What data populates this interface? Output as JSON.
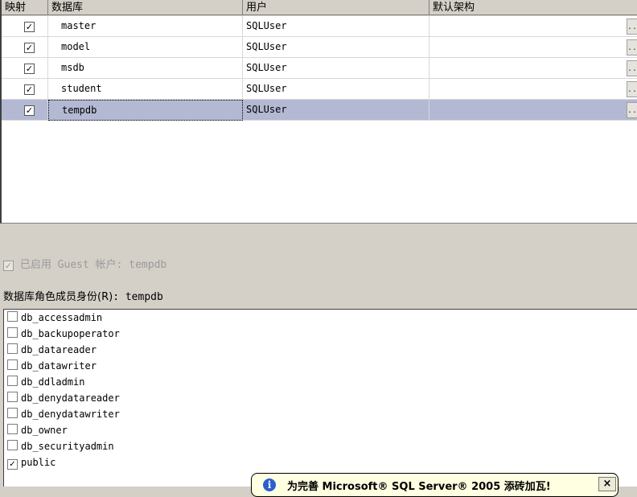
{
  "mapping_grid": {
    "headers": [
      "映射",
      "数据库",
      "用户",
      "默认架构"
    ],
    "rows": [
      {
        "mapped": true,
        "database": "master",
        "user": "SQLUser",
        "schema": "",
        "selected": false
      },
      {
        "mapped": true,
        "database": "model",
        "user": "SQLUser",
        "schema": "",
        "selected": false
      },
      {
        "mapped": true,
        "database": "msdb",
        "user": "SQLUser",
        "schema": "",
        "selected": false
      },
      {
        "mapped": true,
        "database": "student",
        "user": "SQLUser",
        "schema": "",
        "selected": false
      },
      {
        "mapped": true,
        "database": "tempdb",
        "user": "SQLUser",
        "schema": "",
        "selected": true
      }
    ],
    "ellipsis_label": "..",
    "selected_color": "#b3b9d3"
  },
  "guest": {
    "label": "已启用",
    "text": " Guest 帐户: tempdb",
    "checked": true,
    "enabled": false
  },
  "role_membership": {
    "caption_prefix": "数据库角色成员身份",
    "caption_mnemonic": "(R)",
    "caption_suffix": ": tempdb",
    "roles": [
      {
        "name": "db_accessadmin",
        "checked": false
      },
      {
        "name": "db_backupoperator",
        "checked": false
      },
      {
        "name": "db_datareader",
        "checked": false
      },
      {
        "name": "db_datawriter",
        "checked": false
      },
      {
        "name": "db_ddladmin",
        "checked": false
      },
      {
        "name": "db_denydatareader",
        "checked": false
      },
      {
        "name": "db_denydatawriter",
        "checked": false
      },
      {
        "name": "db_owner",
        "checked": false
      },
      {
        "name": "db_securityadmin",
        "checked": false
      },
      {
        "name": "public",
        "checked": true
      }
    ]
  },
  "balloon": {
    "icon": "info-icon",
    "text": "为完善 Microsoft® SQL Server® 2005 添砖加瓦!",
    "close_label": "×"
  },
  "check_glyph": "✓"
}
